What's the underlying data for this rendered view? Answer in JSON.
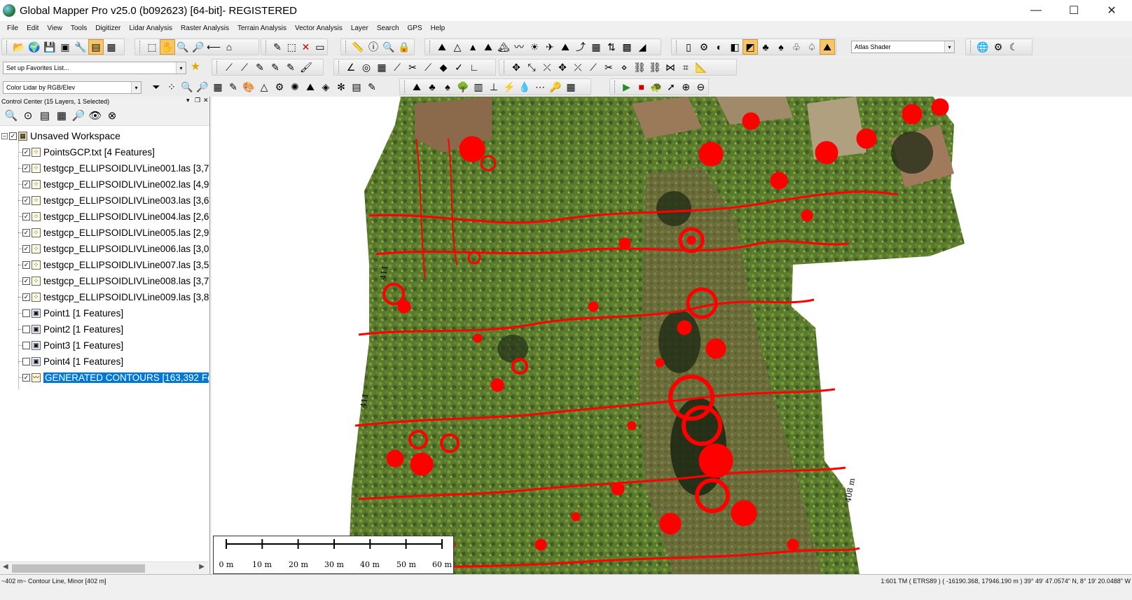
{
  "window": {
    "title": "Global Mapper Pro v25.0 (b092623) [64-bit]- REGISTERED",
    "minimize": "—",
    "maximize": "☐",
    "close": "✕"
  },
  "menu": [
    "File",
    "Edit",
    "View",
    "Tools",
    "Digitizer",
    "Lidar Analysis",
    "Raster Analysis",
    "Terrain Analysis",
    "Vector Analysis",
    "Layer",
    "Search",
    "GPS",
    "Help"
  ],
  "toolbars": {
    "shader_combo": "Atlas Shader",
    "favorites_combo": "Set up Favorites List...",
    "lidar_color_combo": "Color Lidar by RGB/Elev"
  },
  "control_center": {
    "title": "Control Center (15 Layers, 1 Selected)",
    "pin_label": "▾",
    "float_label": "❐",
    "close_label": "✕",
    "root_label": "Unsaved Workspace",
    "layers": [
      {
        "name": "PointsGCP.txt [4 Features]",
        "checked": true,
        "icon": "points-layer-icon"
      },
      {
        "name": "testgcp_ELLIPSOIDLIVLine001.las [3,7",
        "checked": true,
        "icon": "lidar-layer-icon"
      },
      {
        "name": "testgcp_ELLIPSOIDLIVLine002.las [4,9",
        "checked": true,
        "icon": "lidar-layer-icon"
      },
      {
        "name": "testgcp_ELLIPSOIDLIVLine003.las [3,6",
        "checked": true,
        "icon": "lidar-layer-icon"
      },
      {
        "name": "testgcp_ELLIPSOIDLIVLine004.las [2,6",
        "checked": true,
        "icon": "lidar-layer-icon"
      },
      {
        "name": "testgcp_ELLIPSOIDLIVLine005.las [2,9",
        "checked": true,
        "icon": "lidar-layer-icon"
      },
      {
        "name": "testgcp_ELLIPSOIDLIVLine006.las [3,0",
        "checked": true,
        "icon": "lidar-layer-icon"
      },
      {
        "name": "testgcp_ELLIPSOIDLIVLine007.las [3,5",
        "checked": true,
        "icon": "lidar-layer-icon"
      },
      {
        "name": "testgcp_ELLIPSOIDLIVLine008.las [3,7",
        "checked": true,
        "icon": "lidar-layer-icon"
      },
      {
        "name": "testgcp_ELLIPSOIDLIVLine009.las [3,8",
        "checked": true,
        "icon": "lidar-layer-icon"
      },
      {
        "name": "Point1 [1 Features]",
        "checked": false,
        "icon": "vector-layer-icon"
      },
      {
        "name": "Point2 [1 Features]",
        "checked": false,
        "icon": "vector-layer-icon"
      },
      {
        "name": "Point3 [1 Features]",
        "checked": false,
        "icon": "vector-layer-icon"
      },
      {
        "name": "Point4 [1 Features]",
        "checked": false,
        "icon": "vector-layer-icon"
      },
      {
        "name": "GENERATED CONTOURS [163,392 Fe",
        "checked": true,
        "icon": "contour-layer-icon",
        "selected": true
      }
    ]
  },
  "map": {
    "contour_color": "#ff0000",
    "contour_labels": [
      "411",
      "411",
      "408 m"
    ],
    "scale_bar": {
      "labels": [
        "0 m",
        "10 m",
        "20 m",
        "30 m",
        "40 m",
        "50 m",
        "60 m"
      ]
    }
  },
  "status_bar": {
    "left": "~402 m~ Contour Line, Minor [402 m]",
    "right": "1:601  TM ( ETRS89 ) ( -16190.368, 17946.190 m )  39° 49' 47.0574\" N, 8° 19' 20.0488\" W"
  }
}
